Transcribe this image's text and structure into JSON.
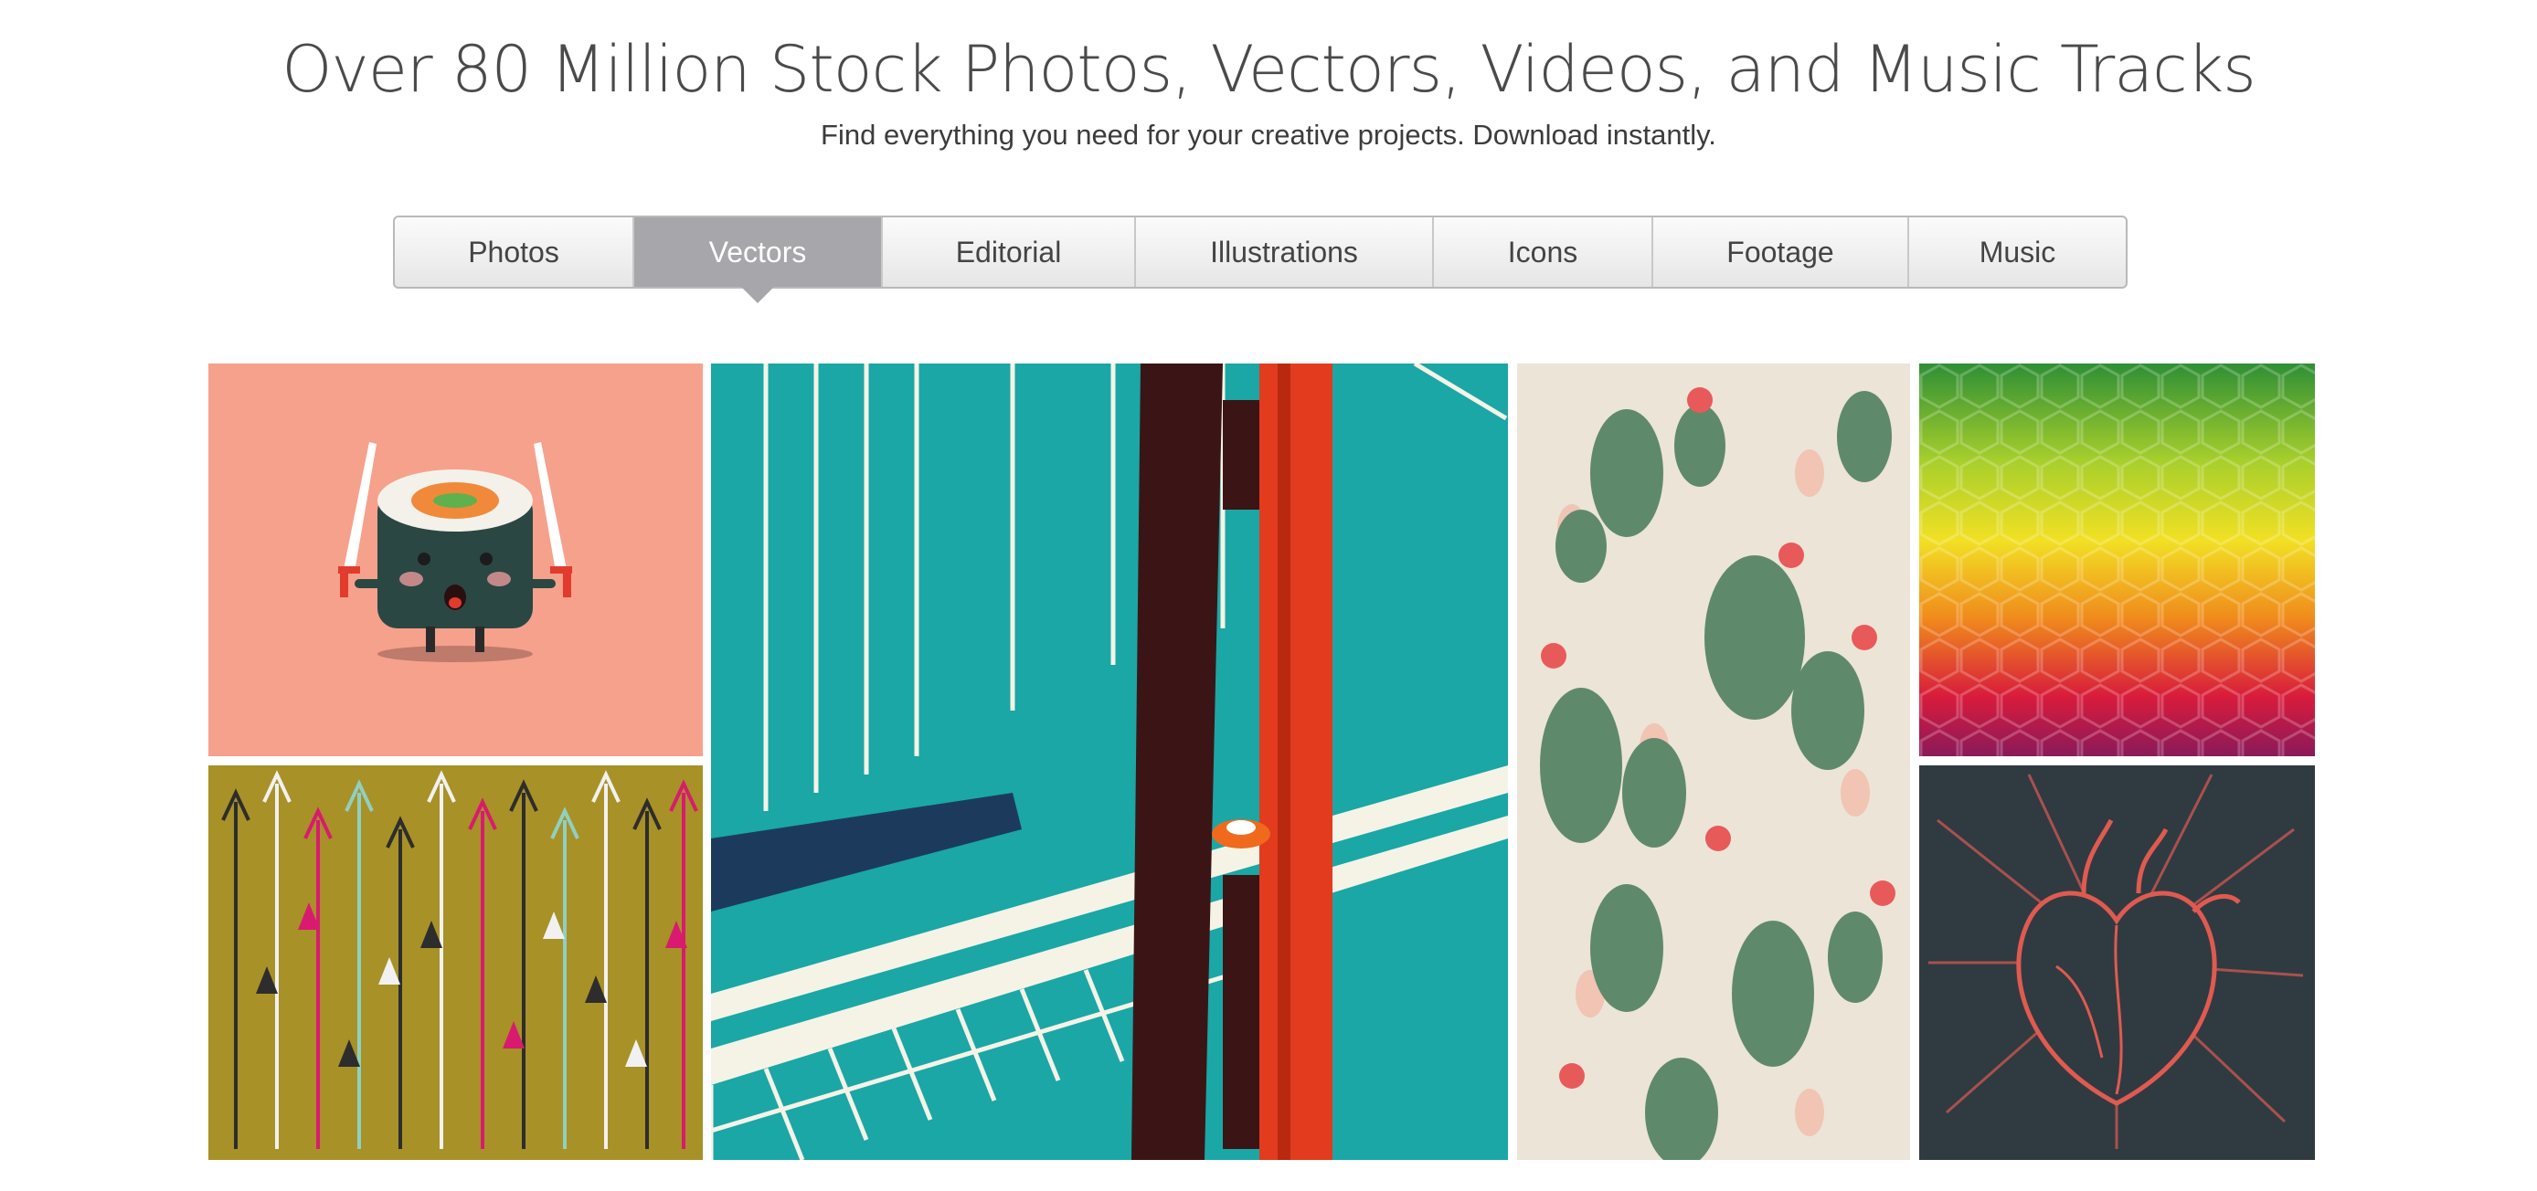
{
  "hero": {
    "title": "Over 80 Million Stock Photos, Vectors, Videos, and Music Tracks",
    "subtitle": "Find everything you need for your creative projects. Download instantly."
  },
  "tabs": [
    {
      "label": "Photos",
      "active": false
    },
    {
      "label": "Vectors",
      "active": true
    },
    {
      "label": "Editorial",
      "active": false
    },
    {
      "label": "Illustrations",
      "active": false
    },
    {
      "label": "Icons",
      "active": false
    },
    {
      "label": "Footage",
      "active": false
    },
    {
      "label": "Music",
      "active": false
    }
  ],
  "gallery": {
    "tiles": [
      {
        "subject": "sushi-samurai-illustration",
        "color": "#f6a18b"
      },
      {
        "subject": "arrows-pattern",
        "color": "#a89127"
      },
      {
        "subject": "golden-gate-bridge-illustration",
        "color": "#1aa7a6"
      },
      {
        "subject": "cactus-pattern",
        "color": "#ece4d6"
      },
      {
        "subject": "hexagon-gradient-pattern",
        "color": "#e8d021"
      },
      {
        "subject": "anatomical-heart-illustration",
        "color": "#2f3b41"
      }
    ]
  }
}
